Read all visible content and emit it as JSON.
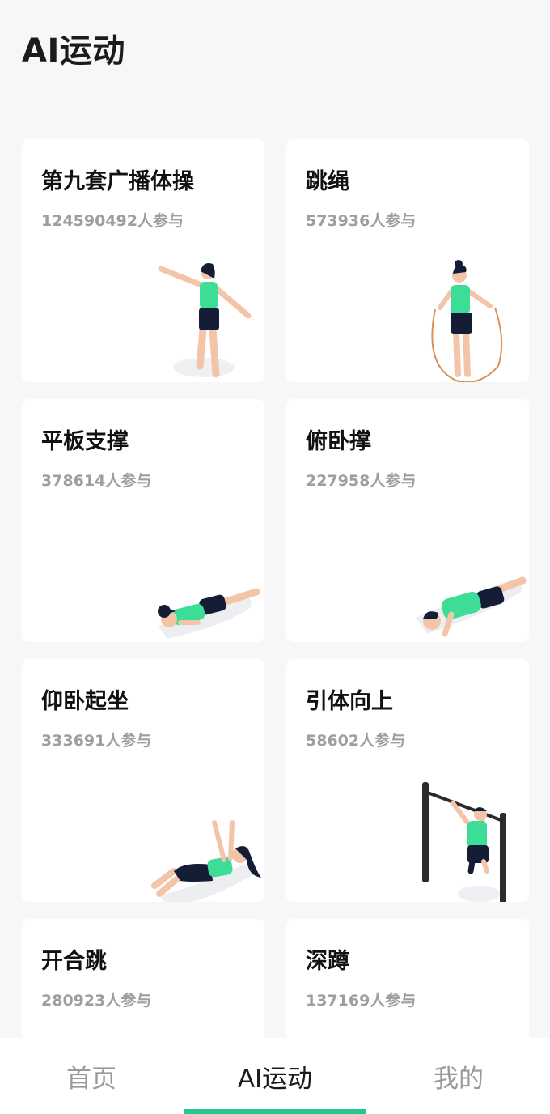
{
  "page": {
    "title": "AI运动"
  },
  "colors": {
    "accent": "#22c98a",
    "figure_top": "#3ddc97",
    "figure_bottom": "#151c35",
    "skin": "#f4c4a8"
  },
  "cards": [
    {
      "title": "第九套广播体操",
      "participants": "124590492人参与",
      "illustration": "standing-arms-out-figure"
    },
    {
      "title": "跳绳",
      "participants": "573936人参与",
      "illustration": "jump-rope-figure"
    },
    {
      "title": "平板支撑",
      "participants": "378614人参与",
      "illustration": "plank-figure"
    },
    {
      "title": "俯卧撑",
      "participants": "227958人参与",
      "illustration": "push-up-figure"
    },
    {
      "title": "仰卧起坐",
      "participants": "333691人参与",
      "illustration": "sit-up-figure"
    },
    {
      "title": "引体向上",
      "participants": "58602人参与",
      "illustration": "pull-up-figure"
    },
    {
      "title": "开合跳",
      "participants": "280923人参与",
      "illustration": "jumping-jack-figure"
    },
    {
      "title": "深蹲",
      "participants": "137169人参与",
      "illustration": "squat-figure"
    }
  ],
  "tabbar": {
    "tabs": [
      {
        "label": "首页"
      },
      {
        "label": "AI运动"
      },
      {
        "label": "我的"
      }
    ],
    "active_index": 1
  }
}
